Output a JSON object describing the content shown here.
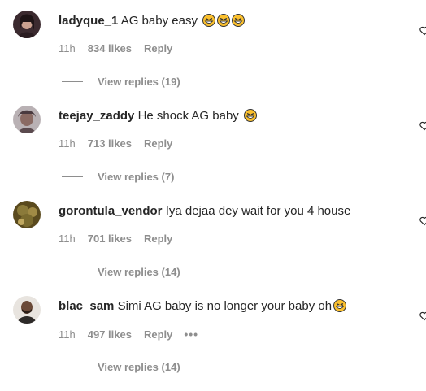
{
  "comments": [
    {
      "username": "ladyque_1",
      "text": "AG baby easy",
      "emoji_count": 3,
      "time": "11h",
      "likes": "834 likes",
      "reply": "Reply",
      "view_replies": "View replies (19)",
      "has_more": false
    },
    {
      "username": "teejay_zaddy",
      "text": "He shock AG baby",
      "emoji_count": 1,
      "time": "11h",
      "likes": "713 likes",
      "reply": "Reply",
      "view_replies": "View replies (7)",
      "has_more": false
    },
    {
      "username": "gorontula_vendor",
      "text": "Iya dejaa dey wait for you 4 house",
      "emoji_count": 0,
      "time": "11h",
      "likes": "701 likes",
      "reply": "Reply",
      "view_replies": "View replies (14)",
      "has_more": false
    },
    {
      "username": "blac_sam",
      "text": "Simi AG baby is no longer your baby oh",
      "emoji_count": 1,
      "time": "11h",
      "likes": "497 likes",
      "reply": "Reply",
      "view_replies": "View replies (14)",
      "has_more": true
    }
  ],
  "icons": {
    "emoji": "grinning-squinting-face-icon",
    "like": "heart-outline-icon",
    "more": "more-options-icon"
  },
  "colors": {
    "text": "#262626",
    "secondary": "#8e8e8e",
    "background": "#ffffff"
  }
}
